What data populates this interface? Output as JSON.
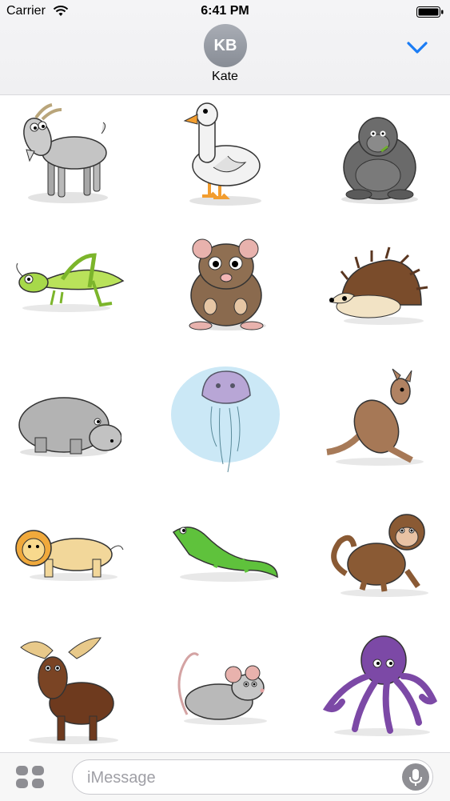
{
  "status_bar": {
    "carrier": "Carrier",
    "time": "6:41 PM",
    "wifi_icon": "wifi-icon",
    "battery_icon": "battery-icon"
  },
  "header": {
    "avatar_initials": "KB",
    "contact_name": "Kate",
    "collapse_icon": "chevron-down-icon",
    "accent": "#1a7cf5"
  },
  "stickers": [
    {
      "name": "goat"
    },
    {
      "name": "goose"
    },
    {
      "name": "gorilla"
    },
    {
      "name": "grasshopper"
    },
    {
      "name": "hamster"
    },
    {
      "name": "hedgehog"
    },
    {
      "name": "hippo"
    },
    {
      "name": "jellyfish"
    },
    {
      "name": "kangaroo"
    },
    {
      "name": "lion"
    },
    {
      "name": "lizard"
    },
    {
      "name": "monkey"
    },
    {
      "name": "moose"
    },
    {
      "name": "mouse"
    },
    {
      "name": "octopus"
    }
  ],
  "composer": {
    "placeholder": "iMessage",
    "apps_icon": "app-drawer-icon",
    "mic_icon": "microphone-icon"
  }
}
